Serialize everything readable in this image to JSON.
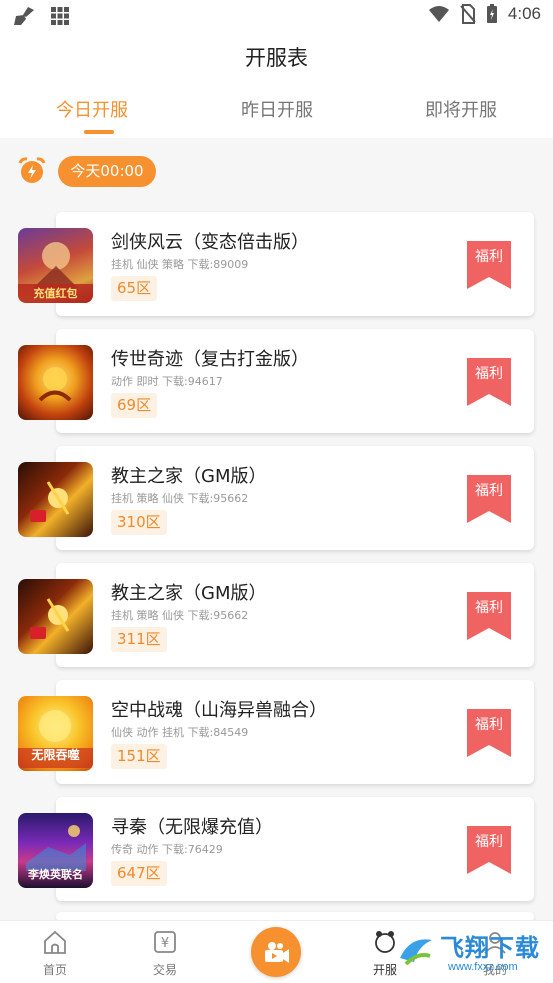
{
  "status_bar": {
    "time": "4:06"
  },
  "header": {
    "title": "开服表",
    "tabs": [
      {
        "label": "今日开服",
        "active": true
      },
      {
        "label": "昨日开服",
        "active": false
      },
      {
        "label": "即将开服",
        "active": false
      }
    ]
  },
  "time_slot": {
    "label": "今天00:00"
  },
  "games": [
    {
      "name": "剑侠风云（变态倍击版）",
      "meta": "挂机 仙侠 策略 下载:89009",
      "zone": "65区",
      "badge": "福利",
      "thumb_text": "充值红包"
    },
    {
      "name": "传世奇迹（复古打金版）",
      "meta": "动作 即时 下载:94617",
      "zone": "69区",
      "badge": "福利",
      "thumb_text": ""
    },
    {
      "name": "教主之家（GM版）",
      "meta": "挂机 策略 仙侠 下载:95662",
      "zone": "310区",
      "badge": "福利",
      "thumb_text": ""
    },
    {
      "name": "教主之家（GM版）",
      "meta": "挂机 策略 仙侠 下载:95662",
      "zone": "311区",
      "badge": "福利",
      "thumb_text": ""
    },
    {
      "name": "空中战魂（山海异兽融合）",
      "meta": "仙侠 动作 挂机 下载:84549",
      "zone": "151区",
      "badge": "福利",
      "thumb_text": "无限吞噬"
    },
    {
      "name": "寻秦（无限爆充值）",
      "meta": "传奇 动作 下载:76429",
      "zone": "647区",
      "badge": "福利",
      "thumb_text": "李焕英联名"
    }
  ],
  "bottom_nav": [
    {
      "label": "首页",
      "icon": "home-icon"
    },
    {
      "label": "交易",
      "icon": "trade-icon"
    },
    {
      "label": "",
      "icon": "video-camera-icon"
    },
    {
      "label": "开服",
      "icon": "server-icon"
    },
    {
      "label": "我的",
      "icon": "profile-icon"
    }
  ],
  "watermark": {
    "text": "飞翔下载",
    "url_text": "www.fxxz.com"
  },
  "colors": {
    "accent": "#f7912f",
    "badge": "#f06363",
    "zone_bg": "#fdf1e4"
  }
}
